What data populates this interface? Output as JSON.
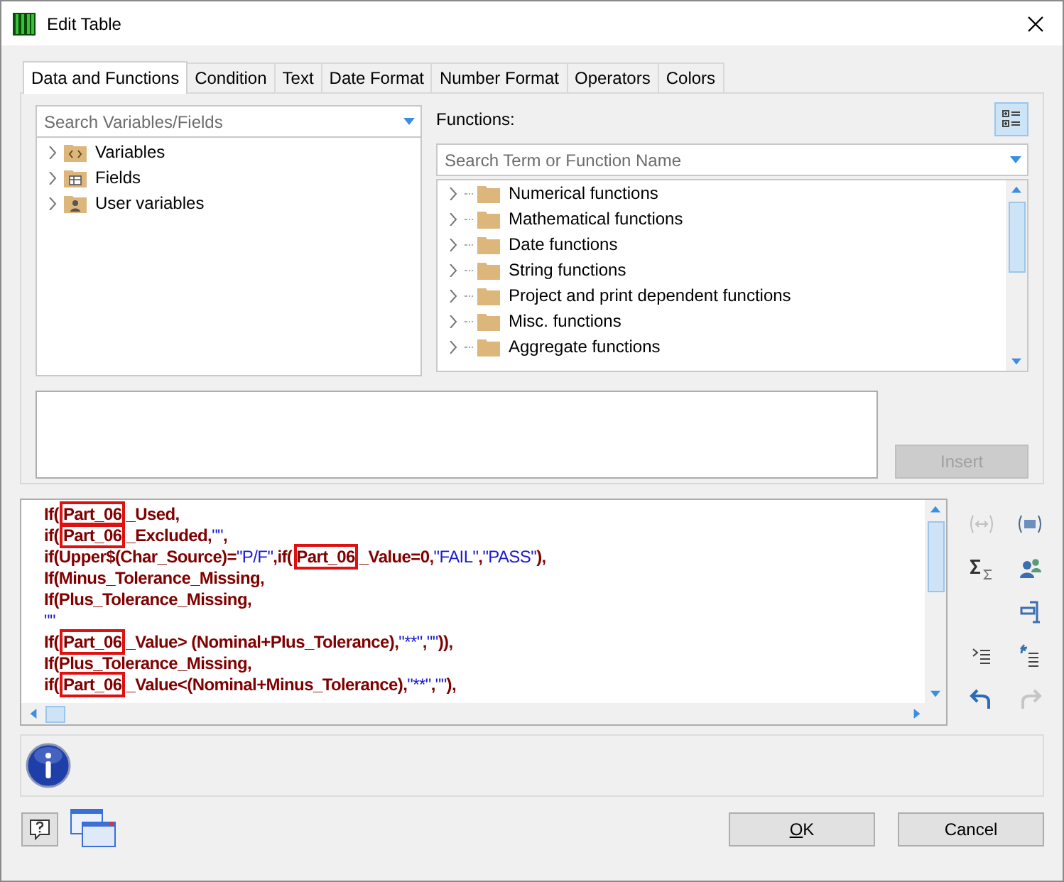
{
  "window": {
    "title": "Edit Table"
  },
  "tabs": [
    {
      "label": "Data and Functions",
      "selected": true
    },
    {
      "label": "Condition",
      "selected": false
    },
    {
      "label": "Text",
      "selected": false
    },
    {
      "label": "Date Format",
      "selected": false
    },
    {
      "label": "Number Format",
      "selected": false
    },
    {
      "label": "Operators",
      "selected": false
    },
    {
      "label": "Colors",
      "selected": false
    }
  ],
  "variables_search": {
    "placeholder": "Search Variables/Fields"
  },
  "variables_tree": [
    {
      "label": "Variables",
      "kind": "variables",
      "expanded": false
    },
    {
      "label": "Fields",
      "kind": "fields",
      "expanded": false
    },
    {
      "label": "User variables",
      "kind": "user",
      "expanded": false
    }
  ],
  "functions_label": "Functions:",
  "functions_search": {
    "placeholder": "Search Term or Function Name"
  },
  "functions_tree": [
    {
      "label": "Numerical functions",
      "expanded": false
    },
    {
      "label": "Mathematical functions",
      "expanded": false
    },
    {
      "label": "Date functions",
      "expanded": false
    },
    {
      "label": "String functions",
      "expanded": false
    },
    {
      "label": "Project and print dependent functions",
      "expanded": false
    },
    {
      "label": "Misc. functions",
      "expanded": false
    },
    {
      "label": "Aggregate functions",
      "expanded": false
    }
  ],
  "insert_button": {
    "label": "Insert",
    "disabled": true
  },
  "code_lines": [
    {
      "segments": [
        {
          "kind": "text",
          "text": "If("
        },
        {
          "kind": "mark",
          "text": "Part_06"
        },
        {
          "kind": "text",
          "text": "_Used,"
        }
      ]
    },
    {
      "segments": [
        {
          "kind": "text",
          "text": "if("
        },
        {
          "kind": "mark",
          "text": "Part_06"
        },
        {
          "kind": "text",
          "text": "_Excluded,"
        },
        {
          "kind": "string",
          "text": "\"\""
        },
        {
          "kind": "text",
          "text": ","
        }
      ]
    },
    {
      "segments": [
        {
          "kind": "text",
          "text": "if(Upper$(Char_Source)="
        },
        {
          "kind": "string",
          "text": "\"P/F\""
        },
        {
          "kind": "text",
          "text": ",if("
        },
        {
          "kind": "mark",
          "text": "Part_06"
        },
        {
          "kind": "text",
          "text": "_Value=0,"
        },
        {
          "kind": "string",
          "text": "\"FAIL\""
        },
        {
          "kind": "text",
          "text": ","
        },
        {
          "kind": "string",
          "text": "\"PASS\""
        },
        {
          "kind": "text",
          "text": "),"
        }
      ]
    },
    {
      "segments": [
        {
          "kind": "text",
          "text": "If(Minus_Tolerance_Missing,"
        }
      ]
    },
    {
      "segments": [
        {
          "kind": "text",
          "text": "If(Plus_Tolerance_Missing,"
        }
      ]
    },
    {
      "segments": [
        {
          "kind": "string",
          "text": "\"\""
        }
      ]
    },
    {
      "segments": [
        {
          "kind": "text",
          "text": "If("
        },
        {
          "kind": "mark",
          "text": "Part_06"
        },
        {
          "kind": "text",
          "text": "_Value> (Nominal+Plus_Tolerance),"
        },
        {
          "kind": "string",
          "text": "\"**\""
        },
        {
          "kind": "text",
          "text": ","
        },
        {
          "kind": "string",
          "text": "\"\""
        },
        {
          "kind": "text",
          "text": ")),"
        }
      ]
    },
    {
      "segments": [
        {
          "kind": "text",
          "text": "If(Plus_Tolerance_Missing,"
        }
      ]
    },
    {
      "segments": [
        {
          "kind": "text",
          "text": "if("
        },
        {
          "kind": "mark",
          "text": "Part_06"
        },
        {
          "kind": "text",
          "text": "_Value<(Nominal+Minus_Tolerance),"
        },
        {
          "kind": "string",
          "text": "\"**\""
        },
        {
          "kind": "text",
          "text": ","
        },
        {
          "kind": "string",
          "text": "\"\""
        },
        {
          "kind": "text",
          "text": "),"
        }
      ]
    }
  ],
  "editor_tools": [
    {
      "kind": "brackets",
      "disabled": true
    },
    {
      "kind": "field",
      "disabled": false
    },
    {
      "kind": "sum",
      "disabled": false
    },
    {
      "kind": "users",
      "disabled": false
    },
    {
      "kind": "format",
      "disabled": false
    },
    {
      "kind": "indent",
      "disabled": false
    },
    {
      "kind": "outdent",
      "disabled": false
    },
    {
      "kind": "undo",
      "disabled": false
    },
    {
      "kind": "redo",
      "disabled": true
    }
  ],
  "buttons": [
    {
      "label": "OK",
      "underlined": true
    },
    {
      "label": "Cancel",
      "underlined": false
    }
  ]
}
